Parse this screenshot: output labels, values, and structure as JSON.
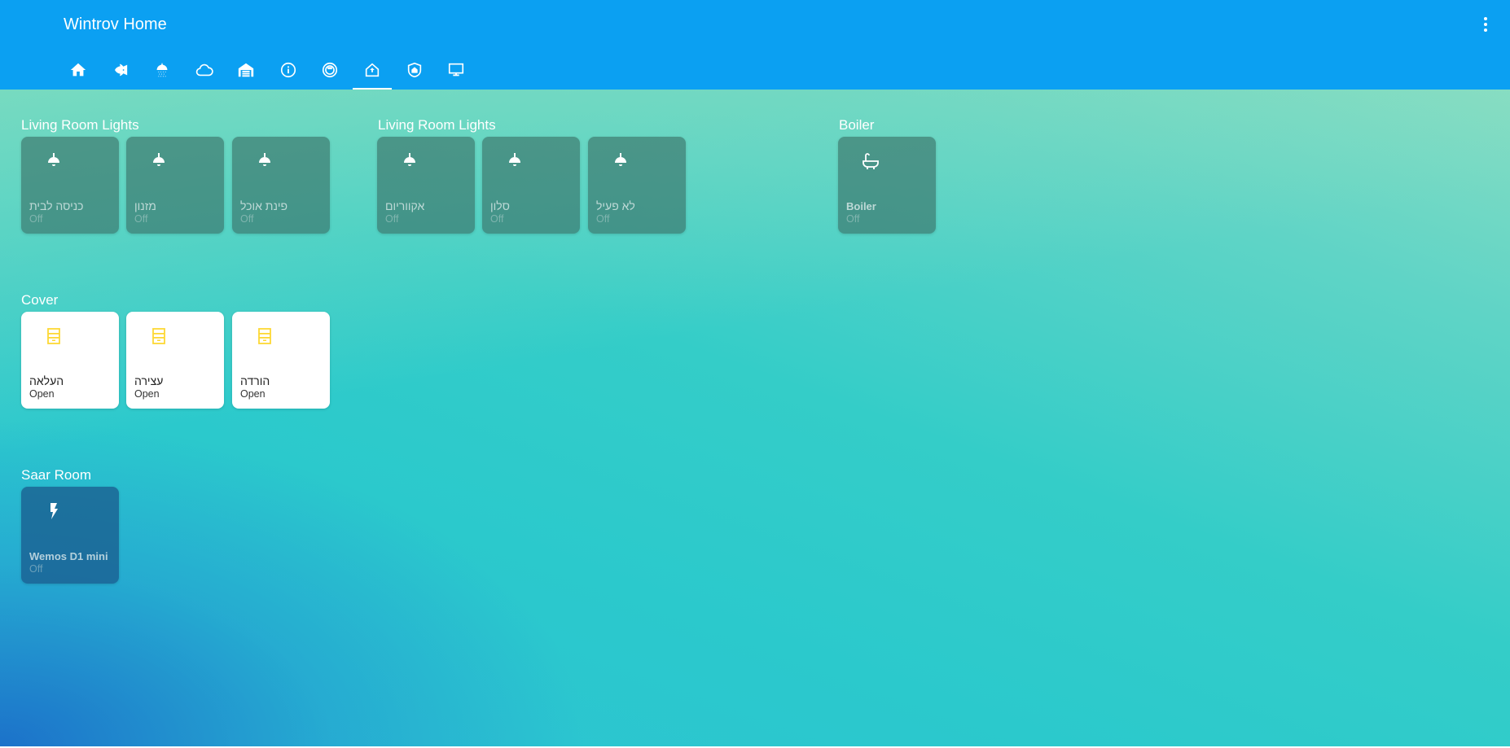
{
  "app": {
    "title": "Wintrov Home"
  },
  "tabs": [
    {
      "icon": "home-icon"
    },
    {
      "icon": "fish-icon"
    },
    {
      "icon": "shower-icon"
    },
    {
      "icon": "cloud-icon"
    },
    {
      "icon": "garage-icon"
    },
    {
      "icon": "info-icon"
    },
    {
      "icon": "robot-vacuum-icon"
    },
    {
      "icon": "home-floor-icon",
      "active": true
    },
    {
      "icon": "home-shield-icon"
    },
    {
      "icon": "monitor-icon"
    }
  ],
  "sections": {
    "lights_a": {
      "title": "Living Room Lights",
      "cards": [
        {
          "name": "כניסה לבית",
          "state": "Off",
          "icon": "ceiling-light-icon"
        },
        {
          "name": "מזנון",
          "state": "Off",
          "icon": "ceiling-light-icon"
        },
        {
          "name": "פינת אוכל",
          "state": "Off",
          "icon": "ceiling-light-icon"
        }
      ]
    },
    "lights_b": {
      "title": "Living Room Lights",
      "cards": [
        {
          "name": "אקווריום",
          "state": "Off",
          "icon": "ceiling-light-icon"
        },
        {
          "name": "סלון",
          "state": "Off",
          "icon": "ceiling-light-icon"
        },
        {
          "name": "לא פעיל",
          "state": "Off",
          "icon": "ceiling-light-icon"
        }
      ]
    },
    "boiler": {
      "title": "Boiler",
      "cards": [
        {
          "name": "Boiler",
          "state": "Off",
          "icon": "bathtub-icon"
        }
      ]
    },
    "cover": {
      "title": "Cover",
      "cards": [
        {
          "name": "העלאה",
          "state": "Open",
          "icon": "window-shutter-icon"
        },
        {
          "name": "עצירה",
          "state": "Open",
          "icon": "window-shutter-icon"
        },
        {
          "name": "הורדה",
          "state": "Open",
          "icon": "window-shutter-icon"
        }
      ]
    },
    "saar": {
      "title": "Saar Room",
      "cards": [
        {
          "name": "Wemos D1 mini",
          "state": "Off",
          "icon": "flash-icon"
        }
      ]
    }
  },
  "colors": {
    "header": "#0ba0f2",
    "cover_icon": "#fdd835",
    "light_icon": "#ffffff"
  }
}
